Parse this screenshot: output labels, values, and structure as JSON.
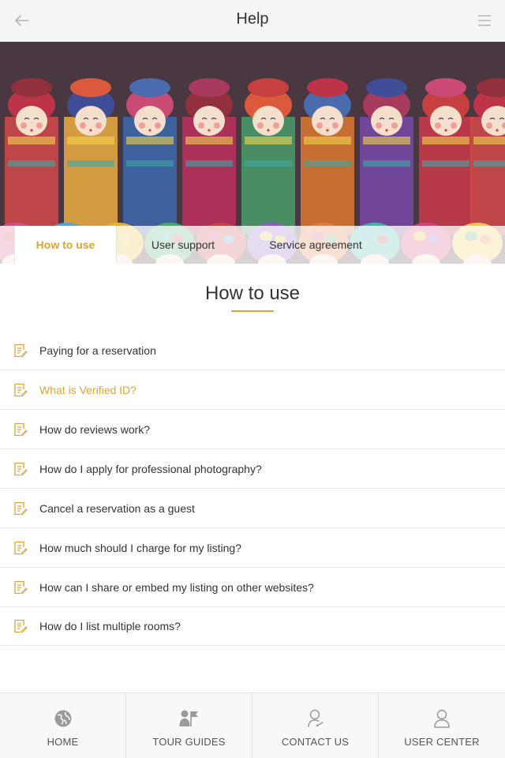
{
  "header": {
    "title": "Help",
    "back_icon": "arrow-left-icon",
    "menu_icon": "hamburger-menu-icon"
  },
  "hero": {
    "image": "colorful-ethnic-dolls-photo"
  },
  "tabs": [
    {
      "label": "How to use",
      "active": true
    },
    {
      "label": "User support",
      "active": false
    },
    {
      "label": "Service agreement",
      "active": false
    }
  ],
  "section": {
    "title": "How to use"
  },
  "faq_items": [
    {
      "label": "Paying for a reservation",
      "highlight": false
    },
    {
      "label": "What is Verified ID?",
      "highlight": true
    },
    {
      "label": "How do reviews work?",
      "highlight": false
    },
    {
      "label": "How do I apply for professional photography?",
      "highlight": false
    },
    {
      "label": "Cancel a reservation as a guest",
      "highlight": false
    },
    {
      "label": "How much should I charge for my listing?",
      "highlight": false
    },
    {
      "label": "How can I share or embed my listing on other websites?",
      "highlight": false
    },
    {
      "label": "How do I list multiple rooms?",
      "highlight": false
    }
  ],
  "bottom_nav": [
    {
      "label": "HOME",
      "icon": "globe-icon"
    },
    {
      "label": "TOUR GUIDES",
      "icon": "guide-flag-icon"
    },
    {
      "label": "CONTACT US",
      "icon": "contact-person-icon"
    },
    {
      "label": "USER CENTER",
      "icon": "user-icon"
    }
  ],
  "colors": {
    "accent": "#d9a53a",
    "text": "#333333",
    "header_bg": "#f5f5f5",
    "divider": "#e8e8e8"
  }
}
